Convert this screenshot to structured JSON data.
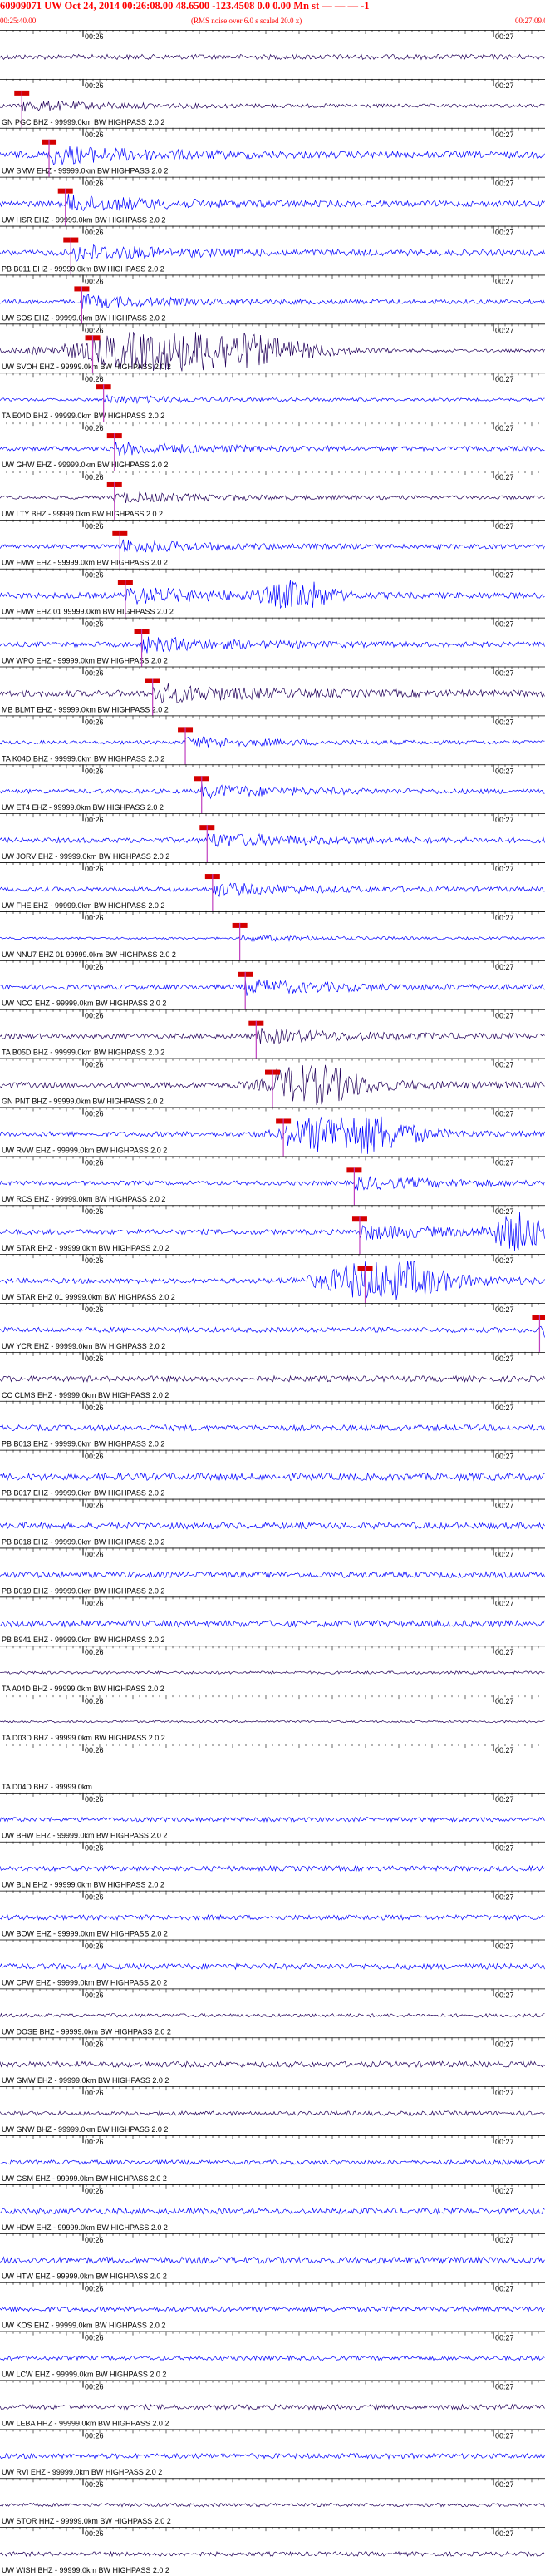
{
  "header": {
    "title": "60909071 UW Oct 24, 2014 00:26:08.00   48.6500 -123.4508  0.0 0.00 Mn st — — — -1",
    "left_time": "00:25:40.00",
    "center_note": "(RMS noise over 6.0 s scaled 20.0 x)",
    "right_time": "00:27:09.00"
  },
  "colors": {
    "trace_blue": "#0000ff",
    "trace_navy": "#22005a",
    "pick_red": "#d40000",
    "header_red": "#ff0000"
  },
  "tick_labels": {
    "left": "00:26",
    "right": "00:27"
  },
  "channels": [
    {
      "label": "",
      "color": "navy",
      "amp": 0.35,
      "pick": null
    },
    {
      "label": "GN PGC BHZ - 99999.0km BW  HIGHPASS  2.0  2",
      "color": "navy",
      "amp": 0.25,
      "pick": 0.04
    },
    {
      "label": "UW SMW EHZ - 99999.0km BW  HIGHPASS  2.0  2",
      "color": "blue",
      "amp": 0.45,
      "pick": 0.09
    },
    {
      "label": "UW HSR EHZ - 99999.0km BW  HIGHPASS  2.0  2",
      "color": "blue",
      "amp": 0.4,
      "pick": 0.12
    },
    {
      "label": "PB B011 EHZ - 99999.0km BW  HIGHPASS  2.0  2",
      "color": "blue",
      "amp": 0.4,
      "pick": 0.13
    },
    {
      "label": "UW SOS EHZ - 99999.0km BW  HIGHPASS  2.0  2",
      "color": "blue",
      "amp": 0.3,
      "pick": 0.15
    },
    {
      "label": "UW SVOH EHZ - 99999.0km BW  HIGHPASS  2.0  2",
      "color": "navy",
      "amp": 0.2,
      "pick": 0.17,
      "burst": {
        "c": 0.35,
        "w": 0.2,
        "a": 1.0
      }
    },
    {
      "label": "TA E04D BHZ - 99999.0km BW  HIGHPASS  2.0  2",
      "color": "blue",
      "amp": 0.2,
      "pick": 0.19
    },
    {
      "label": "UW GHW EHZ - 99999.0km BW  HIGHPASS  2.0  2",
      "color": "blue",
      "amp": 0.3,
      "pick": 0.21
    },
    {
      "label": "UW LTY BHZ - 99999.0km BW  HIGHPASS  2.0  2",
      "color": "navy",
      "amp": 0.25,
      "pick": 0.21
    },
    {
      "label": "UW FMW EHZ - 99999.0km BW  HIGHPASS  2.0  2",
      "color": "blue",
      "amp": 0.3,
      "pick": 0.22
    },
    {
      "label": "UW FMW EHZ 01 99999.0km BW  HIGHPASS  2.0  2",
      "color": "blue",
      "amp": 0.4,
      "pick": 0.23,
      "burst": {
        "c": 0.55,
        "w": 0.06,
        "a": 0.6
      }
    },
    {
      "label": "UW WPO EHZ - 99999.0km BW  HIGHPASS  2.0  2",
      "color": "blue",
      "amp": 0.35,
      "pick": 0.26
    },
    {
      "label": "MB BLMT EHZ - 99999.0km BW  HIGHPASS  2.0  2",
      "color": "navy",
      "amp": 0.45,
      "pick": 0.28
    },
    {
      "label": "TA K04D BHZ - 99999.0km BW  HIGHPASS  2.0  2",
      "color": "blue",
      "amp": 0.25,
      "pick": 0.34
    },
    {
      "label": "UW ET4 EHZ - 99999.0km BW  HIGHPASS  2.0  2",
      "color": "blue",
      "amp": 0.3,
      "pick": 0.37
    },
    {
      "label": "UW JORV EHZ - 99999.0km BW  HIGHPASS  2.0  2",
      "color": "blue",
      "amp": 0.35,
      "pick": 0.38
    },
    {
      "label": "UW FHE EHZ - 99999.0km BW  HIGHPASS  2.0  2",
      "color": "blue",
      "amp": 0.3,
      "pick": 0.39
    },
    {
      "label": "UW NNU7 EHZ 01 99999.0km BW  HIGHPASS  2.0  2",
      "color": "blue",
      "amp": 0.15,
      "pick": 0.44
    },
    {
      "label": "UW NCO EHZ - 99999.0km BW  HIGHPASS  2.0  2",
      "color": "blue",
      "amp": 0.35,
      "pick": 0.45
    },
    {
      "label": "TA B05D BHZ - 99999.0km BW  HIGHPASS  2.0  2",
      "color": "navy",
      "amp": 0.35,
      "pick": 0.47
    },
    {
      "label": "GN PNT BHZ - 99999.0km BW  HIGHPASS  2.0  2",
      "color": "navy",
      "amp": 0.4,
      "pick": 0.5,
      "burst": {
        "c": 0.58,
        "w": 0.08,
        "a": 0.7
      }
    },
    {
      "label": "UW RVW EHZ - 99999.0km BW  HIGHPASS  2.0  2",
      "color": "blue",
      "amp": 0.35,
      "pick": 0.52,
      "burst": {
        "c": 0.65,
        "w": 0.1,
        "a": 0.9
      }
    },
    {
      "label": "UW RCS EHZ - 99999.0km BW  HIGHPASS  2.0  2",
      "color": "blue",
      "amp": 0.3,
      "pick": 0.65
    },
    {
      "label": "UW STAR EHZ - 99999.0km BW  HIGHPASS  2.0  2",
      "color": "blue",
      "amp": 0.35,
      "pick": 0.66,
      "burst": {
        "c": 0.95,
        "w": 0.04,
        "a": 1.0
      }
    },
    {
      "label": "UW STAR EHZ 01 99999.0km BW  HIGHPASS  2.0  2",
      "color": "blue",
      "amp": 0.35,
      "pick": 0.67,
      "burst": {
        "c": 0.7,
        "w": 0.1,
        "a": 1.0
      }
    },
    {
      "label": "UW YCR EHZ - 99999.0km BW  HIGHPASS  2.0  2",
      "color": "blue",
      "amp": 0.35,
      "pick": 0.99
    },
    {
      "label": "CC CLMS EHZ - 99999.0km BW  HIGHPASS  2.0  2",
      "color": "navy",
      "amp": 0.4,
      "pick": null
    },
    {
      "label": "PB B013 EHZ - 99999.0km BW  HIGHPASS  2.0  2",
      "color": "blue",
      "amp": 0.4,
      "pick": null
    },
    {
      "label": "PB B017 EHZ - 99999.0km BW  HIGHPASS  2.0  2",
      "color": "blue",
      "amp": 0.5,
      "pick": null
    },
    {
      "label": "PB B018 EHZ - 99999.0km BW  HIGHPASS  2.0  2",
      "color": "blue",
      "amp": 0.45,
      "pick": null
    },
    {
      "label": "PB B019 EHZ - 99999.0km BW  HIGHPASS  2.0  2",
      "color": "blue",
      "amp": 0.4,
      "pick": null
    },
    {
      "label": "PB B941 EHZ - 99999.0km BW  HIGHPASS  2.0  2",
      "color": "blue",
      "amp": 0.45,
      "pick": null
    },
    {
      "label": "TA A04D BHZ - 99999.0km BW  HIGHPASS  2.0  2",
      "color": "navy",
      "amp": 0.2,
      "pick": null
    },
    {
      "label": "TA D03D BHZ - 99999.0km BW  HIGHPASS  2.0  2",
      "color": "navy",
      "amp": 0.15,
      "pick": null
    },
    {
      "label": "TA D04D BHZ - 99999.0km",
      "color": "navy",
      "amp": 0.0,
      "pick": null
    },
    {
      "label": "UW BHW EHZ - 99999.0km BW  HIGHPASS  2.0  2",
      "color": "blue",
      "amp": 0.3,
      "pick": null
    },
    {
      "label": "UW BLN EHZ - 99999.0km BW  HIGHPASS  2.0  2",
      "color": "blue",
      "amp": 0.35,
      "pick": null
    },
    {
      "label": "UW BOW EHZ - 99999.0km BW  HIGHPASS  2.0  2",
      "color": "blue",
      "amp": 0.35,
      "pick": null
    },
    {
      "label": "UW CPW EHZ - 99999.0km BW  HIGHPASS  2.0  2",
      "color": "blue",
      "amp": 0.4,
      "pick": null
    },
    {
      "label": "UW DOSE BHZ - 99999.0km BW  HIGHPASS  2.0  2",
      "color": "navy",
      "amp": 0.25,
      "pick": null
    },
    {
      "label": "UW GMW EHZ - 99999.0km BW  HIGHPASS  2.0  2",
      "color": "navy",
      "amp": 0.4,
      "pick": null
    },
    {
      "label": "UW GNW BHZ - 99999.0km BW  HIGHPASS  2.0  2",
      "color": "navy",
      "amp": 0.3,
      "pick": null
    },
    {
      "label": "UW GSM EHZ - 99999.0km BW  HIGHPASS  2.0  2",
      "color": "blue",
      "amp": 0.3,
      "pick": null
    },
    {
      "label": "UW HDW EHZ - 99999.0km BW  HIGHPASS  2.0  2",
      "color": "blue",
      "amp": 0.4,
      "pick": null
    },
    {
      "label": "UW HTW EHZ - 99999.0km BW  HIGHPASS  2.0  2",
      "color": "blue",
      "amp": 0.45,
      "pick": null
    },
    {
      "label": "UW KOS EHZ - 99999.0km BW  HIGHPASS  2.0  2",
      "color": "blue",
      "amp": 0.35,
      "pick": null
    },
    {
      "label": "UW LCW EHZ - 99999.0km BW  HIGHPASS  2.0  2",
      "color": "blue",
      "amp": 0.3,
      "pick": null
    },
    {
      "label": "UW LEBA HHZ - 99999.0km BW  HIGHPASS  2.0  2",
      "color": "navy",
      "amp": 0.35,
      "pick": null
    },
    {
      "label": "UW RVI EHZ - 99999.0km BW  HIGHPASS  2.0  2",
      "color": "blue",
      "amp": 0.35,
      "pick": null
    },
    {
      "label": "UW STOR HHZ - 99999.0km BW  HIGHPASS  2.0  2",
      "color": "navy",
      "amp": 0.25,
      "pick": null
    },
    {
      "label": "UW WISH BHZ - 99999.0km BW  HIGHPASS  2.0  2",
      "color": "navy",
      "amp": 0.3,
      "pick": null
    }
  ]
}
